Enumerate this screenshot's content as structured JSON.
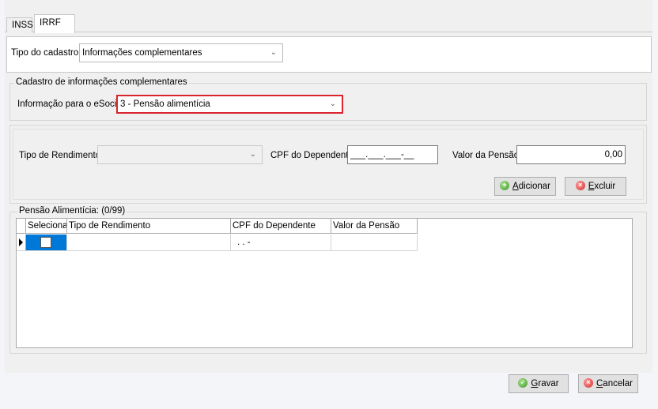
{
  "tabs": [
    {
      "label": "INSS",
      "active": false
    },
    {
      "label": "IRRF",
      "active": true
    }
  ],
  "tipo_cadastro": {
    "label": "Tipo do cadastro:",
    "value": "Informações complementares"
  },
  "complementares_group": {
    "title": "Cadastro de informações complementares",
    "info_label": "Informação para o eSocial:",
    "info_value": "3 - Pensão alimentícia"
  },
  "form": {
    "tipo_rendimento_label": "Tipo de Rendimento:",
    "tipo_rendimento_value": "",
    "cpf_label": "CPF do Dependente:",
    "cpf_mask": "___.___.___-__",
    "valor_label": "Valor da Pensão:",
    "valor_value": "0,00",
    "add_button": {
      "pre": "",
      "underline": "A",
      "post": "dicionar"
    },
    "delete_button": {
      "pre": "",
      "underline": "E",
      "post": "xcluir"
    }
  },
  "pensao_group": {
    "title": "Pensão Alimentícia: (0/99)",
    "columns": [
      "Selecionar",
      "Tipo de Rendimento",
      "CPF do Dependente",
      "Valor da Pensão"
    ],
    "rows": [
      {
        "selecionar": false,
        "tipo_rendimento": "",
        "cpf": " .  .  -",
        "valor": ""
      }
    ]
  },
  "footer": {
    "save_button": {
      "pre": "",
      "underline": "G",
      "post": "ravar"
    },
    "cancel_button": {
      "pre": "",
      "underline": "C",
      "post": "ancelar"
    }
  },
  "colors": {
    "highlight_border": "#d9232d",
    "selected_cell": "#0078d7"
  },
  "icons": {
    "add": "plus-circle-green-icon",
    "delete": "x-circle-red-icon",
    "save": "check-circle-green-icon",
    "cancel": "x-circle-red-icon",
    "row_indicator": "row-pointer-icon",
    "combo_arrow": "chevron-down-icon"
  }
}
